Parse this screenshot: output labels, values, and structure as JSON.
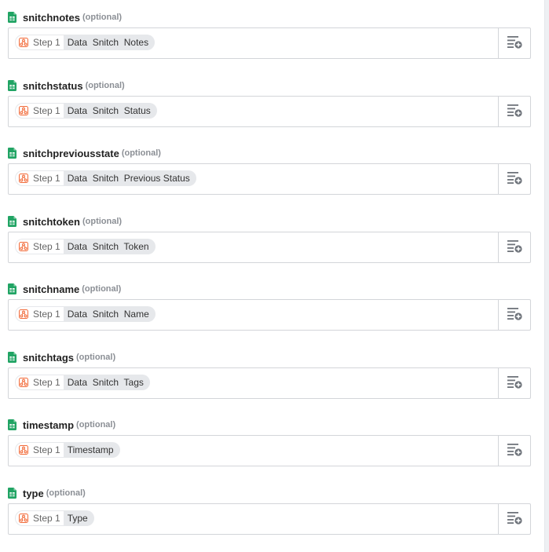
{
  "colors": {
    "sheet_green": "#21a464",
    "step_orange": "#f26b3a",
    "icon_gray": "#6f747b"
  },
  "fields": [
    {
      "name": "snitchnotes",
      "optional": "(optional)",
      "step": "Step 1",
      "value": "Data  Snitch  Notes"
    },
    {
      "name": "snitchstatus",
      "optional": "(optional)",
      "step": "Step 1",
      "value": "Data  Snitch  Status"
    },
    {
      "name": "snitchpreviousstate",
      "optional": "(optional)",
      "step": "Step 1",
      "value": "Data  Snitch  Previous Status"
    },
    {
      "name": "snitchtoken",
      "optional": "(optional)",
      "step": "Step 1",
      "value": "Data  Snitch  Token"
    },
    {
      "name": "snitchname",
      "optional": "(optional)",
      "step": "Step 1",
      "value": "Data  Snitch  Name"
    },
    {
      "name": "snitchtags",
      "optional": "(optional)",
      "step": "Step 1",
      "value": "Data  Snitch  Tags"
    },
    {
      "name": "timestamp",
      "optional": "(optional)",
      "step": "Step 1",
      "value": "Timestamp"
    },
    {
      "name": "type",
      "optional": "(optional)",
      "step": "Step 1",
      "value": "Type"
    }
  ],
  "icons": {
    "field_icon": "google-sheets-icon",
    "step_icon": "step-app-icon",
    "action_icon": "insert-field-icon"
  }
}
